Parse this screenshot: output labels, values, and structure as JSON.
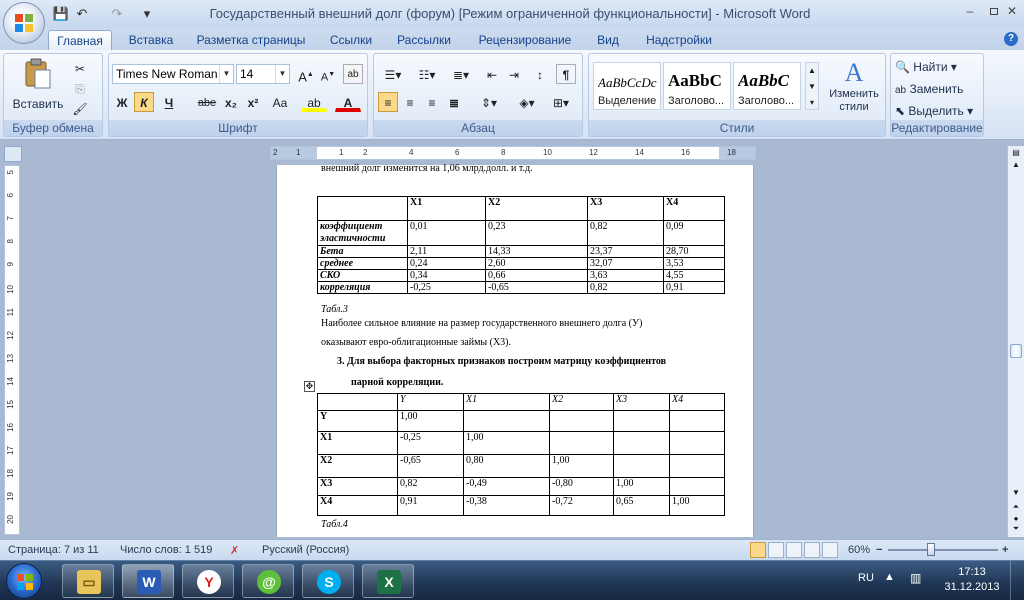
{
  "window": {
    "title": "Государственный внешний долг (форум) [Режим ограниченной функциональности] - Microsoft Word",
    "minimize": "–",
    "close": "✕"
  },
  "qat": {
    "save_icon": "💾",
    "undo_icon": "↶",
    "redo_icon": "↷",
    "more": "▾"
  },
  "tabs": [
    "Главная",
    "Вставка",
    "Разметка страницы",
    "Ссылки",
    "Рассылки",
    "Рецензирование",
    "Вид",
    "Надстройки"
  ],
  "ribbon": {
    "clipboard": {
      "paste": "Вставить",
      "label": "Буфер обмена"
    },
    "font": {
      "name": "Times New Roman",
      "size": "14",
      "label": "Шрифт",
      "bold": "Ж",
      "italic": "К",
      "underline": "Ч",
      "strike": "abe",
      "sub": "x₂",
      "sup": "x²",
      "case": "Aa"
    },
    "paragraph": {
      "label": "Абзац"
    },
    "styles": {
      "items": [
        {
          "preview": "AaBbCcDc",
          "name": "Выделение"
        },
        {
          "preview": "AaBbC",
          "name": "Заголово..."
        },
        {
          "preview": "AaBbC",
          "name": "Заголово..."
        }
      ],
      "change": "Изменить стили",
      "label": "Стили"
    },
    "editing": {
      "find": "Найти",
      "replace": "Заменить",
      "select": "Выделить",
      "label": "Редактирование"
    }
  },
  "ruler": {
    "h_ticks": [
      "2",
      "1",
      "1",
      "2",
      "4",
      "6",
      "8",
      "10",
      "12",
      "14",
      "16",
      "18"
    ],
    "v_ticks": [
      "5",
      "6",
      "7",
      "8",
      "9",
      "10",
      "11",
      "12",
      "13",
      "14",
      "15",
      "16",
      "17",
      "18",
      "19",
      "20"
    ]
  },
  "document": {
    "top_line": "внешний долг изменится на 1,06 млрд.долл. и т.д.",
    "table3": {
      "header": [
        "",
        "X1",
        "X2",
        "X3",
        "X4"
      ],
      "rows": [
        [
          "коэффициент эластичности",
          "0,01",
          "0,23",
          "0,82",
          "0,09"
        ],
        [
          "Бета",
          "2,11",
          "14,33",
          "23,37",
          "28,70"
        ],
        [
          "среднее",
          "0,24",
          "2,60",
          "32,07",
          "3,53"
        ],
        [
          "СКО",
          "0,34",
          "0,66",
          "3,63",
          "4,55"
        ],
        [
          "корреляция",
          "-0,25",
          "-0,65",
          "0,82",
          "0,91"
        ]
      ],
      "caption": "Табл.3"
    },
    "para1": "Наиболее сильное влияние на размер государственного внешнего долга (У)",
    "para2": "оказывают  евро-облигационные займы (Х3).",
    "heading": "3.  Для выбора факторных признаков  построим матрицу  коэффициентов",
    "heading2": "парной корреляции.",
    "table4": {
      "header": [
        "",
        "Y",
        "X1",
        "X2",
        "X3",
        "X4"
      ],
      "rows": [
        [
          "Y",
          "1,00",
          "",
          "",
          "",
          ""
        ],
        [
          "X1",
          "-0,25",
          "1,00",
          "",
          "",
          ""
        ],
        [
          "X2",
          "-0,65",
          "0,80",
          "1,00",
          "",
          ""
        ],
        [
          "X3",
          "0,82",
          "-0,49",
          "-0,80",
          "1,00",
          ""
        ],
        [
          "X4",
          "0,91",
          "-0,38",
          "-0,72",
          "0,65",
          "1,00"
        ]
      ],
      "caption": "Табл.4"
    }
  },
  "status": {
    "page": "Страница: 7 из 11",
    "words": "Число слов: 1 519",
    "language": "Русский (Россия)",
    "zoom": "60%",
    "zoom_minus": "−",
    "zoom_plus": "+"
  },
  "taskbar": {
    "lang": "RU",
    "time": "17:13",
    "date": "31.12.2013"
  },
  "colors": {
    "accent": "#15428b",
    "ribbon_bg": "#dde8f6",
    "taskbar": "#1f3553"
  }
}
